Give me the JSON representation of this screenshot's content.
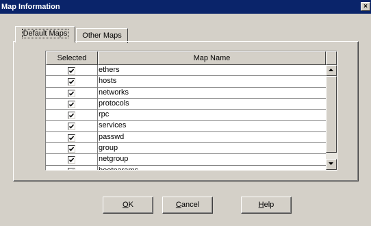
{
  "window": {
    "title": "Map Information",
    "close_glyph": "×"
  },
  "tabs": [
    {
      "label": "Default Maps",
      "selected": true
    },
    {
      "label": "Other Maps",
      "selected": false
    }
  ],
  "table": {
    "columns": [
      "Selected",
      "Map Name"
    ],
    "rows": [
      {
        "selected": true,
        "name": "ethers"
      },
      {
        "selected": true,
        "name": "hosts"
      },
      {
        "selected": true,
        "name": "networks"
      },
      {
        "selected": true,
        "name": "protocols"
      },
      {
        "selected": true,
        "name": "rpc"
      },
      {
        "selected": true,
        "name": "services"
      },
      {
        "selected": true,
        "name": "passwd"
      },
      {
        "selected": true,
        "name": "group"
      },
      {
        "selected": true,
        "name": "netgroup"
      },
      {
        "selected": true,
        "name": "bootparams"
      }
    ]
  },
  "buttons": {
    "ok": {
      "mnemonic": "O",
      "rest": "K"
    },
    "cancel": {
      "mnemonic": "C",
      "rest": "ancel"
    },
    "help": {
      "mnemonic": "H",
      "rest": "elp"
    }
  },
  "icons": {
    "checkbox": "check-icon",
    "scroll_up": "arrow-up-icon",
    "scroll_down": "arrow-down-icon",
    "close": "close-icon"
  }
}
